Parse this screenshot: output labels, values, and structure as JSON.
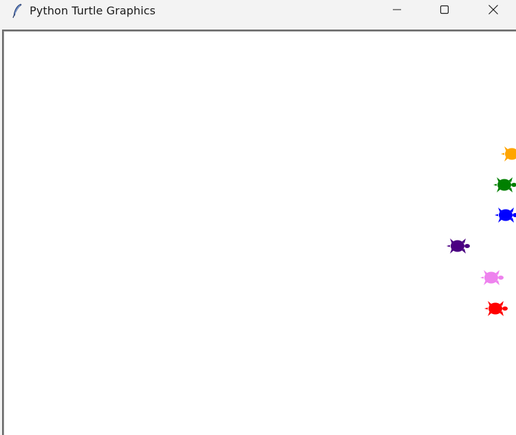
{
  "window": {
    "title": "Python Turtle Graphics",
    "app_icon": "feather-icon",
    "controls": {
      "minimize_icon": "minimize-icon",
      "maximize_icon": "maximize-icon",
      "close_icon": "close-icon"
    }
  },
  "canvas": {
    "background": "#ffffff",
    "turtles": [
      {
        "name": "orange",
        "color": "#ffa500",
        "heading": "east"
      },
      {
        "name": "green",
        "color": "#008000",
        "heading": "east"
      },
      {
        "name": "blue",
        "color": "#0000ff",
        "heading": "east"
      },
      {
        "name": "purple",
        "color": "#4b0082",
        "heading": "east"
      },
      {
        "name": "violet",
        "color": "#ee82ee",
        "heading": "east"
      },
      {
        "name": "red",
        "color": "#ff0000",
        "heading": "east"
      }
    ]
  }
}
